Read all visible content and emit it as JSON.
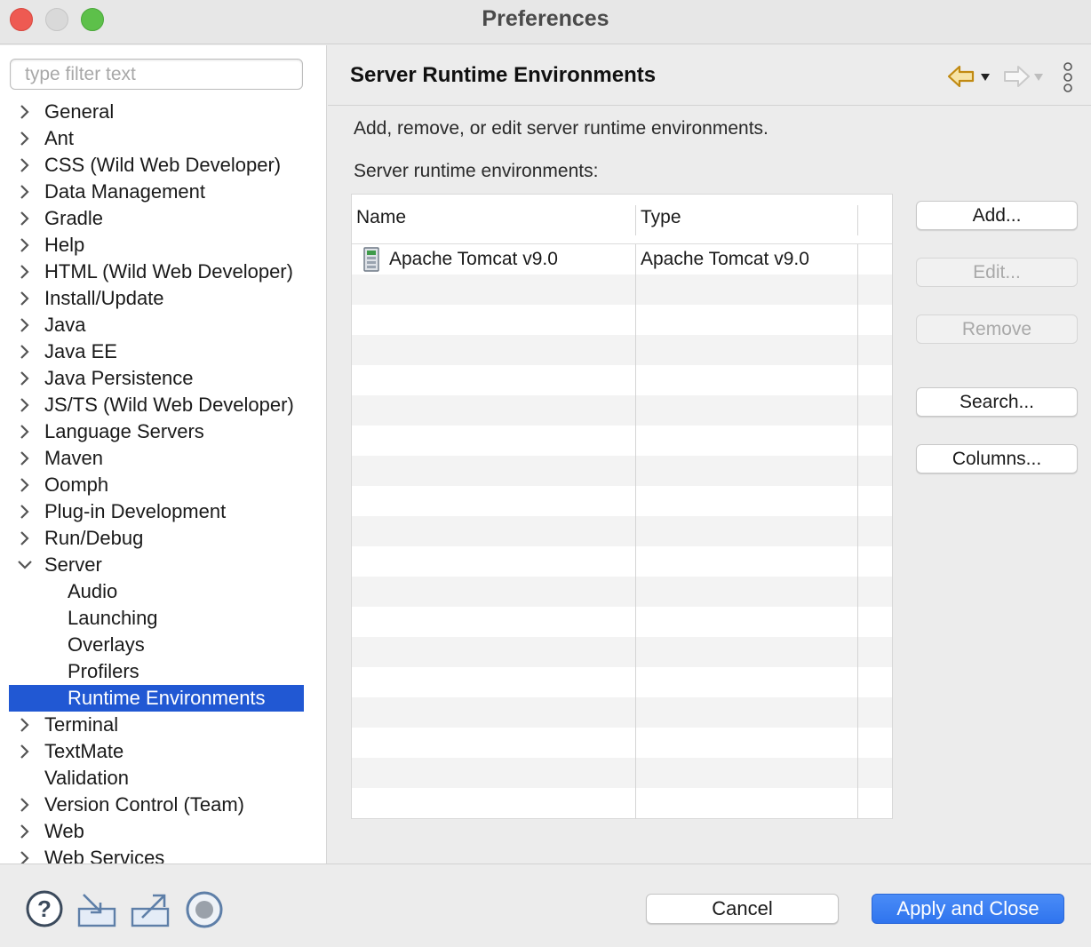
{
  "window": {
    "title": "Preferences"
  },
  "filter": {
    "placeholder": "type filter text",
    "value": ""
  },
  "tree": [
    {
      "label": "General",
      "expandable": true,
      "expanded": false,
      "level": 0
    },
    {
      "label": "Ant",
      "expandable": true,
      "expanded": false,
      "level": 0
    },
    {
      "label": "CSS (Wild Web Developer)",
      "expandable": true,
      "expanded": false,
      "level": 0
    },
    {
      "label": "Data Management",
      "expandable": true,
      "expanded": false,
      "level": 0
    },
    {
      "label": "Gradle",
      "expandable": true,
      "expanded": false,
      "level": 0
    },
    {
      "label": "Help",
      "expandable": true,
      "expanded": false,
      "level": 0
    },
    {
      "label": "HTML (Wild Web Developer)",
      "expandable": true,
      "expanded": false,
      "level": 0
    },
    {
      "label": "Install/Update",
      "expandable": true,
      "expanded": false,
      "level": 0
    },
    {
      "label": "Java",
      "expandable": true,
      "expanded": false,
      "level": 0
    },
    {
      "label": "Java EE",
      "expandable": true,
      "expanded": false,
      "level": 0
    },
    {
      "label": "Java Persistence",
      "expandable": true,
      "expanded": false,
      "level": 0
    },
    {
      "label": "JS/TS (Wild Web Developer)",
      "expandable": true,
      "expanded": false,
      "level": 0
    },
    {
      "label": "Language Servers",
      "expandable": true,
      "expanded": false,
      "level": 0
    },
    {
      "label": "Maven",
      "expandable": true,
      "expanded": false,
      "level": 0
    },
    {
      "label": "Oomph",
      "expandable": true,
      "expanded": false,
      "level": 0
    },
    {
      "label": "Plug-in Development",
      "expandable": true,
      "expanded": false,
      "level": 0
    },
    {
      "label": "Run/Debug",
      "expandable": true,
      "expanded": false,
      "level": 0
    },
    {
      "label": "Server",
      "expandable": true,
      "expanded": true,
      "level": 0
    },
    {
      "label": "Audio",
      "expandable": false,
      "level": 1
    },
    {
      "label": "Launching",
      "expandable": false,
      "level": 1
    },
    {
      "label": "Overlays",
      "expandable": false,
      "level": 1
    },
    {
      "label": "Profilers",
      "expandable": false,
      "level": 1
    },
    {
      "label": "Runtime Environments",
      "expandable": false,
      "level": 1,
      "selected": true
    },
    {
      "label": "Terminal",
      "expandable": true,
      "expanded": false,
      "level": 0
    },
    {
      "label": "TextMate",
      "expandable": true,
      "expanded": false,
      "level": 0
    },
    {
      "label": "Validation",
      "expandable": false,
      "level": 0
    },
    {
      "label": "Version Control (Team)",
      "expandable": true,
      "expanded": false,
      "level": 0
    },
    {
      "label": "Web",
      "expandable": true,
      "expanded": false,
      "level": 0
    },
    {
      "label": "Web Services",
      "expandable": true,
      "expanded": false,
      "level": 0
    }
  ],
  "page": {
    "title": "Server Runtime Environments",
    "description": "Add, remove, or edit server runtime environments.",
    "list_label": "Server runtime environments:"
  },
  "table": {
    "columns": [
      "Name",
      "Type"
    ],
    "rows": [
      {
        "name": "Apache Tomcat v9.0",
        "type": "Apache Tomcat v9.0",
        "icon": "server-icon"
      }
    ]
  },
  "buttons": {
    "add": "Add...",
    "edit": "Edit...",
    "remove": "Remove",
    "search": "Search...",
    "columns": "Columns..."
  },
  "footer": {
    "cancel": "Cancel",
    "apply_close": "Apply and Close"
  },
  "colors": {
    "selection": "#2158d3",
    "primary_button": "#2f74ee",
    "nav_arrow_active": "#d19a1e"
  }
}
